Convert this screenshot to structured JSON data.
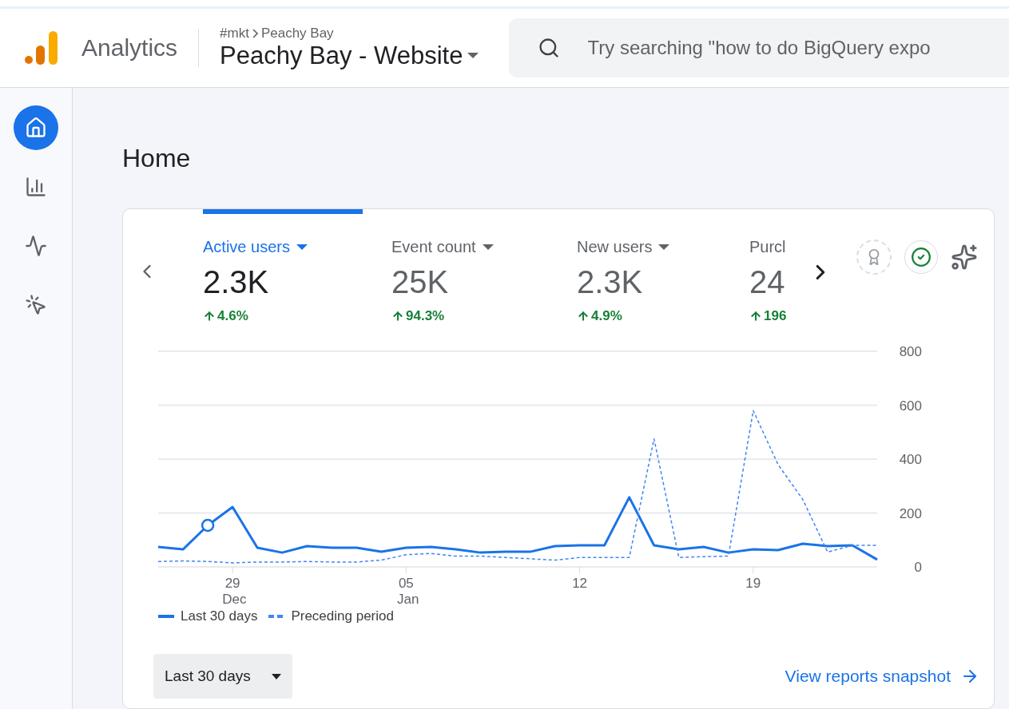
{
  "header": {
    "product": "Analytics",
    "breadcrumb": [
      "#mkt",
      "Peachy Bay"
    ],
    "property": "Peachy Bay - Website",
    "search": {
      "placeholder": "Try searching \"how to do BigQuery expo"
    }
  },
  "nav": [
    {
      "selected": true
    },
    {
      "selected": false
    },
    {
      "selected": false
    },
    {
      "selected": false
    }
  ],
  "page_title": "Home",
  "metrics": [
    {
      "label": "Active users",
      "value": "2.3K",
      "change": "4.6%",
      "selected": true
    },
    {
      "label": "Event count",
      "value": "25K",
      "change": "94.3%",
      "selected": false
    },
    {
      "label": "New users",
      "value": "2.3K",
      "change": "4.9%",
      "selected": false
    },
    {
      "label": "Purcl",
      "value": "24",
      "change": "196",
      "selected": false
    }
  ],
  "chart": {
    "chart_data": {
      "type": "line",
      "x": [
        -5,
        -4,
        -3,
        -2,
        -1,
        0,
        1,
        2,
        3,
        4,
        5,
        6,
        7,
        8,
        9,
        10,
        11,
        12,
        13,
        14,
        15,
        16,
        17,
        18,
        19,
        20,
        21,
        22,
        23,
        24
      ],
      "xlim": [
        -5,
        24
      ],
      "grid": true,
      "series": [
        {
          "name": "Last 30 days",
          "color": "#1a73e8",
          "line_style": "solid",
          "values": [
            74,
            65,
            154,
            222,
            71,
            53,
            77,
            71,
            71,
            56,
            71,
            74,
            65,
            53,
            56,
            56,
            77,
            80,
            80,
            258,
            80,
            65,
            74,
            53,
            65,
            62,
            86,
            77,
            80,
            27
          ]
        },
        {
          "name": "Preceding period",
          "color": "#4285f4",
          "line_style": "dashed",
          "values": [
            20,
            22,
            20,
            15,
            18,
            18,
            20,
            18,
            18,
            25,
            45,
            50,
            40,
            40,
            35,
            30,
            25,
            35,
            35,
            35,
            475,
            35,
            38,
            40,
            580,
            380,
            250,
            55,
            80,
            80
          ]
        }
      ],
      "xticks": [
        {
          "value": -2,
          "label": "29 Dec"
        },
        {
          "value": 5,
          "label": "05 Jan"
        },
        {
          "value": 12,
          "label": "12"
        },
        {
          "value": 19,
          "label": "19"
        }
      ],
      "ylim": [
        0,
        800
      ],
      "yticks": [
        0,
        200,
        400,
        600,
        800
      ]
    }
  },
  "date_range": "Last 30 days",
  "snapshot_link": "View reports snapshot"
}
